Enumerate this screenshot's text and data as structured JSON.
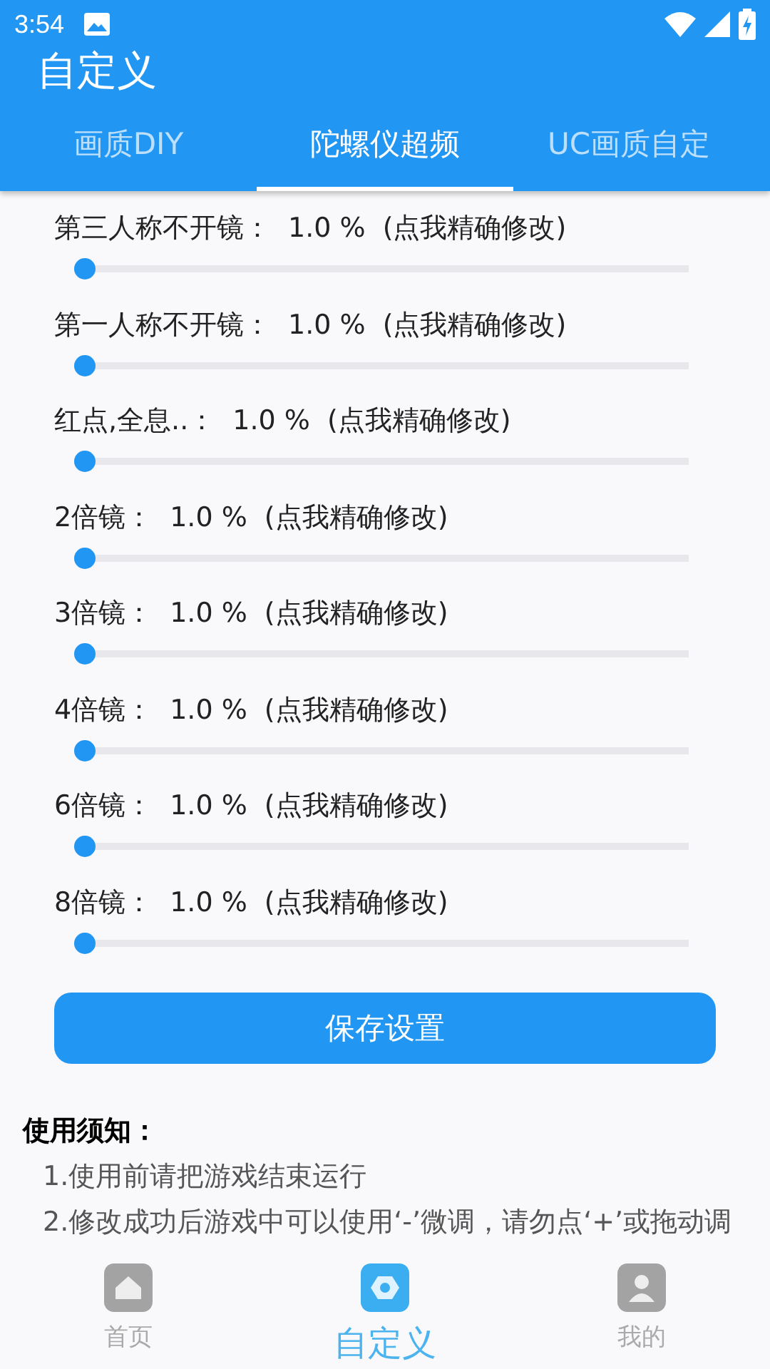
{
  "status_bar": {
    "time": "3:54"
  },
  "app_bar": {
    "title": "自定义"
  },
  "tabs": [
    {
      "label": "画质DIY",
      "selected": false
    },
    {
      "label": "陀螺仪超频",
      "selected": true
    },
    {
      "label": "UC画质自定",
      "selected": false
    }
  ],
  "sliders": [
    {
      "name": "第三人称不开镜：",
      "reading": "1.0 %",
      "action": "(点我精确修改)",
      "level": 0
    },
    {
      "name": "第一人称不开镜：",
      "reading": "1.0 %",
      "action": "(点我精确修改)",
      "level": 0
    },
    {
      "name": "红点,全息..：",
      "reading": "1.0 %",
      "action": "(点我精确修改)",
      "level": 0
    },
    {
      "name": "2倍镜：",
      "reading": "1.0 %",
      "action": "(点我精确修改)",
      "level": 0
    },
    {
      "name": "3倍镜：",
      "reading": "1.0 %",
      "action": "(点我精确修改)",
      "level": 0
    },
    {
      "name": "4倍镜：",
      "reading": "1.0 %",
      "action": "(点我精确修改)",
      "level": 0
    },
    {
      "name": "6倍镜：",
      "reading": "1.0 %",
      "action": "(点我精确修改)",
      "level": 0
    },
    {
      "name": "8倍镜：",
      "reading": "1.0 %",
      "action": "(点我精确修改)",
      "level": 0
    }
  ],
  "save_button": "保存设置",
  "notice": {
    "title": "使用须知：",
    "lines": [
      "1.使用前请把游戏结束运行",
      "2.修改成功后游戏中可以使用‘-’微调，请勿点‘+’或拖动调"
    ]
  },
  "bottom_nav": [
    {
      "label": "首页",
      "kind": "home",
      "selected": false
    },
    {
      "label": "自定义",
      "kind": "custom",
      "selected": true
    },
    {
      "label": "我的",
      "kind": "profile",
      "selected": false
    }
  ]
}
